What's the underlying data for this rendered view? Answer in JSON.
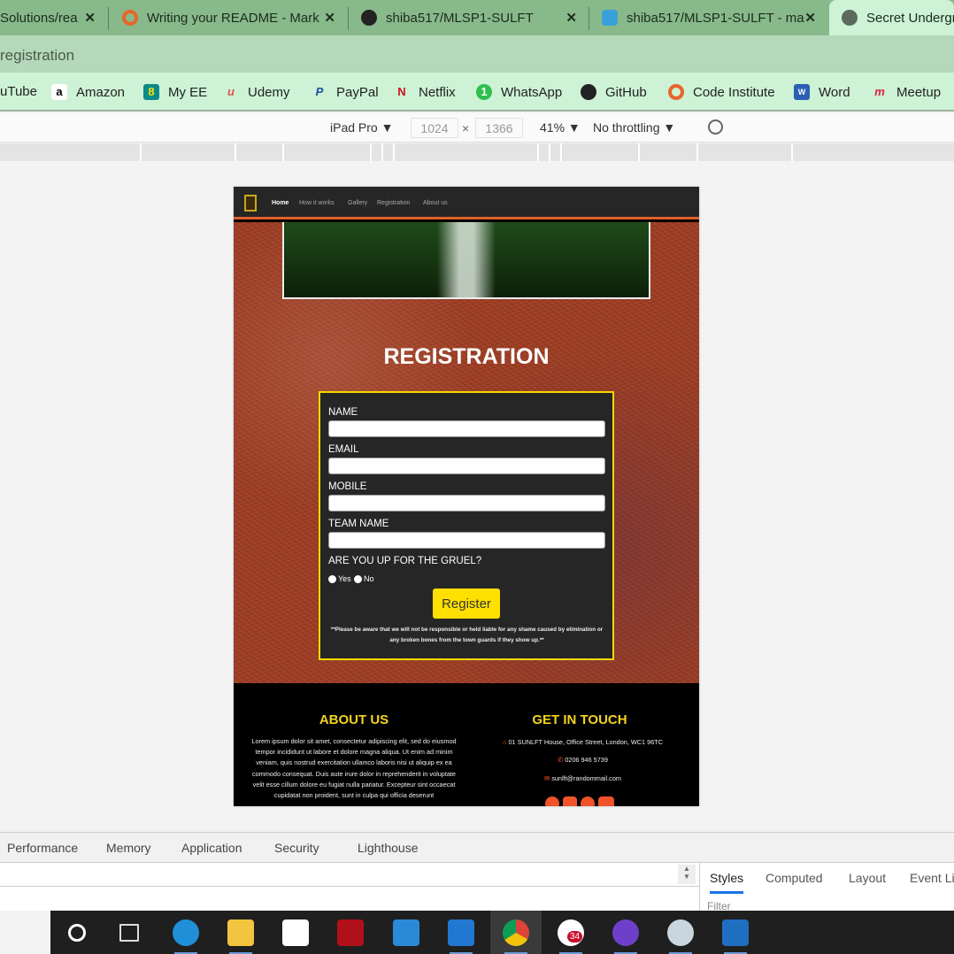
{
  "browser": {
    "tabs": [
      {
        "label": "Solutions/rea",
        "close": "✕"
      },
      {
        "label": "Writing your README - Mark",
        "close": "✕"
      },
      {
        "label": "shiba517/MLSP1-SULFT",
        "close": "✕"
      },
      {
        "label": "shiba517/MLSP1-SULFT - ma",
        "close": "✕"
      },
      {
        "label": "Secret Undergr"
      }
    ],
    "address": "registration",
    "bookmarks": [
      "uTube",
      "Amazon",
      "My EE",
      "Udemy",
      "PayPal",
      "Netflix",
      "WhatsApp",
      "GitHub",
      "Code Institute",
      "Word",
      "Meetup"
    ]
  },
  "device_toolbar": {
    "device": "iPad Pro ▼",
    "width": "1024",
    "times": "×",
    "height": "1366",
    "zoom": "41% ▼",
    "throttling": "No throttling ▼"
  },
  "site": {
    "nav": [
      "Home",
      "How it works",
      "Gallery",
      "Registration",
      "About us"
    ],
    "title": "REGISTRATION",
    "form": {
      "name_label": "NAME",
      "email_label": "EMAIL",
      "mobile_label": "MOBILE",
      "team_label": "TEAM NAME",
      "question": "ARE YOU UP FOR THE GRUEL?",
      "yes": "Yes",
      "no": "No",
      "submit": "Register",
      "note": "**Please be aware that we will not be responsible or held liable for any shame caused by elimination or any broken bones from the town guards if they show up.**"
    },
    "footer": {
      "about_title": "ABOUT US",
      "about_text": "Lorem ipsum dolor sit amet, consectetur adipiscing elit, sed do eiusmod tempor incididunt ut labore et dolore magna aliqua. Ut enim ad minim veniam, quis nostrud exercitation ullamco laboris nisi ut aliquip ex ea commodo consequat. Duis aute irure dolor in reprehenderit in voluptate velit esse cillum dolore eu fugiat nulla pariatur. Excepteur sint occaecat cupidatat non proident, sunt in culpa qui officia deserunt",
      "contact_title": "GET IN TOUCH",
      "address": "01 SUNLFT House, Office Street, London, WC1 96TC",
      "phone": "0206 946 5739",
      "email": "sunlft@randommail.com"
    }
  },
  "devtools": {
    "tabs": [
      "Performance",
      "Memory",
      "Application",
      "Security",
      "Lighthouse"
    ],
    "side_tabs": [
      "Styles",
      "Computed",
      "Layout",
      "Event Li"
    ],
    "filter_placeholder": "Filter"
  },
  "taskbar": {
    "slack_badge": "34"
  },
  "colors": {
    "accent_yellow": "#f2d900",
    "nav_orange": "#e0612a",
    "hero_rust": "#9e3e24"
  }
}
